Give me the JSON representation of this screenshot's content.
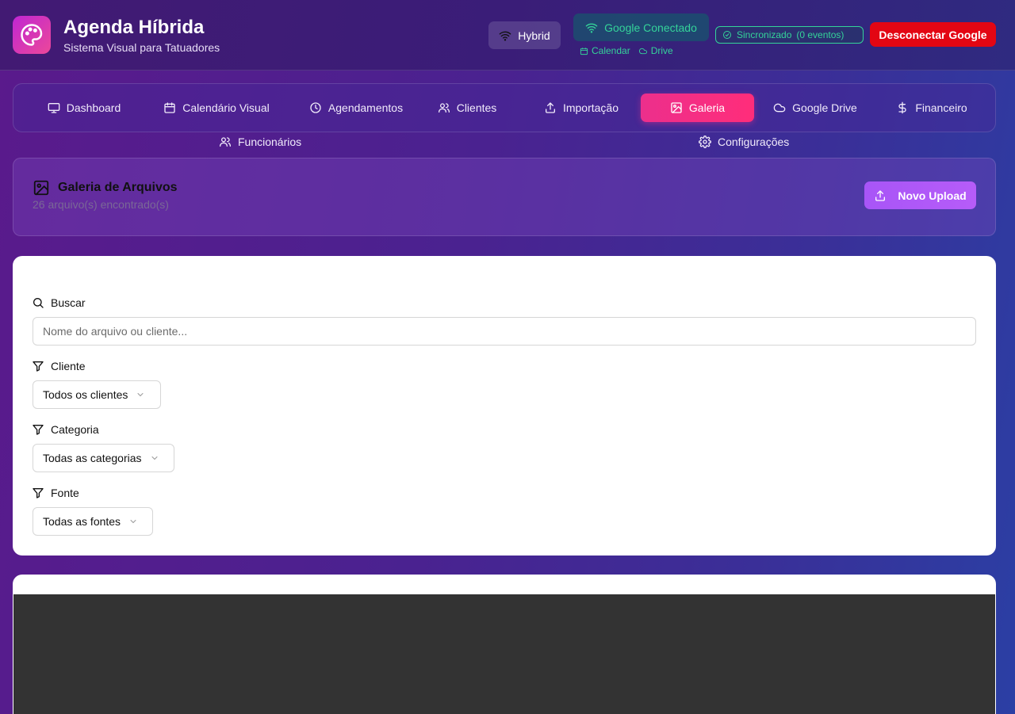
{
  "header": {
    "title": "Agenda Híbrida",
    "subtitle": "Sistema Visual para Tatuadores",
    "mode_label": "Hybrid",
    "google_status": "Google Conectado",
    "google_services": [
      "Calendar",
      "Drive"
    ],
    "sync_label": "Sincronizado",
    "sync_count": "(0 eventos)",
    "disconnect_label": "Desconectar Google"
  },
  "nav": {
    "items": [
      {
        "label": "Dashboard",
        "icon": "monitor-icon"
      },
      {
        "label": "Calendário Visual",
        "icon": "calendar-icon"
      },
      {
        "label": "Agendamentos",
        "icon": "clock-icon"
      },
      {
        "label": "Clientes",
        "icon": "users-icon"
      },
      {
        "label": "Importação",
        "icon": "upload-icon"
      },
      {
        "label": "Galeria",
        "icon": "image-icon",
        "active": true
      },
      {
        "label": "Google Drive",
        "icon": "cloud-icon"
      },
      {
        "label": "Financeiro",
        "icon": "dollar-icon"
      },
      {
        "label": "Funcionários",
        "icon": "users-icon"
      },
      {
        "label": "Configurações",
        "icon": "gear-icon"
      }
    ]
  },
  "gallery": {
    "title": "Galeria de Arquivos",
    "count_text": "26 arquivo(s) encontrado(s)",
    "upload_label": "Novo Upload"
  },
  "filters": {
    "search_label": "Buscar",
    "search_placeholder": "Nome do arquivo ou cliente...",
    "client_label": "Cliente",
    "client_value": "Todos os clientes",
    "category_label": "Categoria",
    "category_value": "Todas as categorias",
    "source_label": "Fonte",
    "source_value": "Todas as fontes"
  },
  "colors": {
    "accent_pink": "#ec2f8c",
    "accent_purple": "#a855f7",
    "success_green": "#34d399",
    "danger_red": "#e30613"
  }
}
